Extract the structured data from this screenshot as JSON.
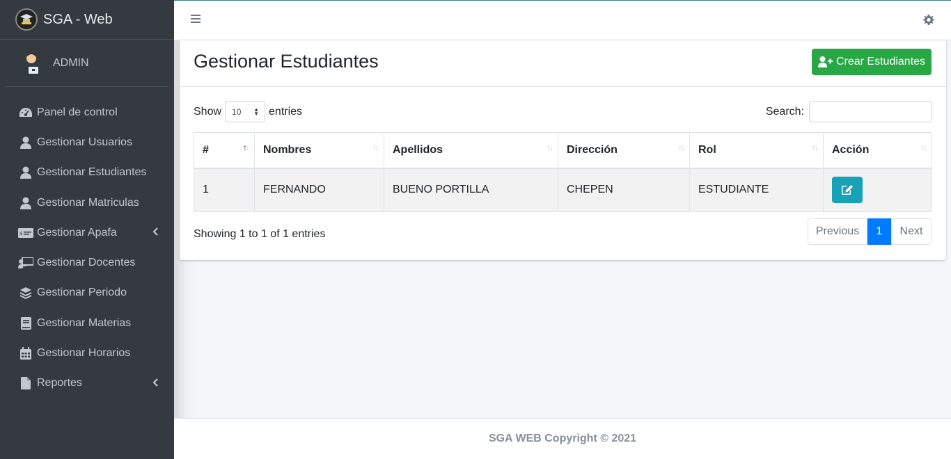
{
  "brand": {
    "title": "SGA - Web"
  },
  "user": {
    "name": "ADMIN"
  },
  "sidebar": {
    "items": [
      {
        "label": "Panel de control",
        "icon": "tachometer-icon",
        "has_arrow": false
      },
      {
        "label": "Gestionar Usuarios",
        "icon": "user-icon",
        "has_arrow": false
      },
      {
        "label": "Gestionar Estudiantes",
        "icon": "user-icon",
        "has_arrow": false
      },
      {
        "label": "Gestionar Matriculas",
        "icon": "user-icon",
        "has_arrow": false
      },
      {
        "label": "Gestionar Apafa",
        "icon": "money-check-icon",
        "has_arrow": true
      },
      {
        "label": "Gestionar Docentes",
        "icon": "chalkboard-teacher-icon",
        "has_arrow": false
      },
      {
        "label": "Gestionar Periodo",
        "icon": "layer-group-icon",
        "has_arrow": false
      },
      {
        "label": "Gestionar Materias",
        "icon": "book-icon",
        "has_arrow": false
      },
      {
        "label": "Gestionar Horarios",
        "icon": "calendar-icon",
        "has_arrow": false
      },
      {
        "label": "Reportes",
        "icon": "file-icon",
        "has_arrow": true
      }
    ]
  },
  "main": {
    "title": "Gestionar Estudiantes",
    "create_label": "Crear Estudiantes",
    "show_label": "Show",
    "entries_value": "10",
    "entries_label": "entries",
    "search_label": "Search:",
    "search_value": "",
    "table": {
      "headers": [
        "#",
        "Nombres",
        "Apellidos",
        "Dirección",
        "Rol",
        "Acción"
      ],
      "rows": [
        [
          "1",
          "FERNANDO",
          "BUENO PORTILLA",
          "CHEPEN",
          "ESTUDIANTE"
        ]
      ]
    },
    "info": "Showing 1 to 1 of 1 entries",
    "pagination": {
      "previous": "Previous",
      "current": "1",
      "next": "Next"
    }
  },
  "footer": {
    "text": "SGA WEB Copyright © 2021"
  },
  "colors": {
    "sidebar": "#343a40",
    "create": "#28a745",
    "edit": "#17a2b8",
    "page_active": "#007bff"
  }
}
